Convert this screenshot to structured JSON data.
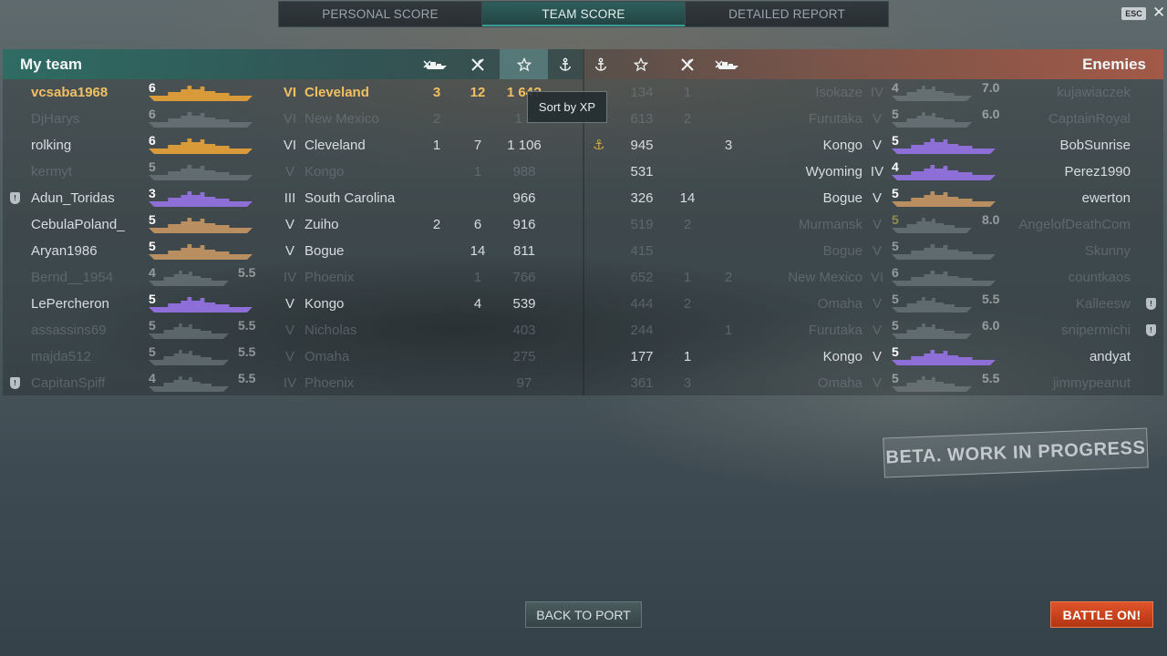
{
  "tabs": [
    {
      "label": "PERSONAL SCORE",
      "active": false
    },
    {
      "label": "TEAM SCORE",
      "active": true
    },
    {
      "label": "DETAILED REPORT",
      "active": false
    }
  ],
  "esc_label": "ESC",
  "close_glyph": "✕",
  "my_team": {
    "title": "My team",
    "columns": [
      "ships-destroyed-icon",
      "planes-destroyed-icon",
      "xp-star-icon",
      "base-capture-anchor-icon"
    ],
    "sorted_by": "xp",
    "rows": [
      {
        "name": "vcsaba1968",
        "lvl": "6",
        "tier": "VI",
        "ship": "Cleveland",
        "color": "#d99b3a",
        "kills": "3",
        "planes": "12",
        "xp": "1 64?",
        "cap": "",
        "player": true,
        "dim": false,
        "clan": false,
        "rating": ""
      },
      {
        "name": "DjHarys",
        "lvl": "6",
        "tier": "VI",
        "ship": "New Mexico",
        "color": "#8a969a",
        "kills": "2",
        "planes": "",
        "xp": "1 4",
        "cap": "",
        "player": false,
        "dim": true,
        "clan": false,
        "rating": ""
      },
      {
        "name": "rolking",
        "lvl": "6",
        "tier": "VI",
        "ship": "Cleveland",
        "color": "#d99b3a",
        "kills": "1",
        "planes": "7",
        "xp": "1 106",
        "cap": "",
        "player": false,
        "dim": false,
        "clan": false,
        "rating": ""
      },
      {
        "name": "kermyt",
        "lvl": "5",
        "tier": "V",
        "ship": "Kongo",
        "color": "#8a969a",
        "kills": "",
        "planes": "1",
        "xp": "988",
        "cap": "",
        "player": false,
        "dim": true,
        "clan": false,
        "rating": ""
      },
      {
        "name": "Adun_Toridas",
        "lvl": "3",
        "tier": "III",
        "ship": "South Carolina",
        "color": "#8e6fd8",
        "kills": "",
        "planes": "",
        "xp": "966",
        "cap": "",
        "player": false,
        "dim": false,
        "clan": true,
        "rating": ""
      },
      {
        "name": "CebulaPoland_",
        "lvl": "5",
        "tier": "V",
        "ship": "Zuiho",
        "color": "#b98f62",
        "kills": "2",
        "planes": "6",
        "xp": "916",
        "cap": "",
        "player": false,
        "dim": false,
        "clan": false,
        "rating": ""
      },
      {
        "name": "Aryan1986",
        "lvl": "5",
        "tier": "V",
        "ship": "Bogue",
        "color": "#b98f62",
        "kills": "",
        "planes": "14",
        "xp": "811",
        "cap": "",
        "player": false,
        "dim": false,
        "clan": false,
        "rating": ""
      },
      {
        "name": "Bernd__1954",
        "lvl": "4",
        "tier": "IV",
        "ship": "Phoenix",
        "color": "#8a969a",
        "kills": "",
        "planes": "1",
        "xp": "766",
        "cap": "",
        "player": false,
        "dim": true,
        "clan": false,
        "rating": "5.5"
      },
      {
        "name": "LePercheron",
        "lvl": "5",
        "tier": "V",
        "ship": "Kongo",
        "color": "#8e6fd8",
        "kills": "",
        "planes": "4",
        "xp": "539",
        "cap": "",
        "player": false,
        "dim": false,
        "clan": false,
        "rating": ""
      },
      {
        "name": "assassins69",
        "lvl": "5",
        "tier": "V",
        "ship": "Nicholas",
        "color": "#8a969a",
        "kills": "",
        "planes": "",
        "xp": "403",
        "cap": "",
        "player": false,
        "dim": true,
        "clan": false,
        "rating": "5.5"
      },
      {
        "name": "majda512",
        "lvl": "5",
        "tier": "V",
        "ship": "Omaha",
        "color": "#8a969a",
        "kills": "",
        "planes": "",
        "xp": "275",
        "cap": "",
        "player": false,
        "dim": true,
        "clan": false,
        "rating": "5.5"
      },
      {
        "name": "CapitanSpiff",
        "lvl": "4",
        "tier": "IV",
        "ship": "Phoenix",
        "color": "#8a969a",
        "kills": "",
        "planes": "",
        "xp": "97",
        "cap": "",
        "player": false,
        "dim": true,
        "clan": true,
        "rating": "5.5"
      }
    ]
  },
  "enemies": {
    "title": "Enemies",
    "columns": [
      "base-capture-anchor-icon",
      "xp-star-icon",
      "planes-destroyed-icon",
      "ships-destroyed-icon"
    ],
    "rows": [
      {
        "name": "kujawiaczek",
        "lvl": "4",
        "tier": "IV",
        "ship": "Isokaze",
        "color": "#8a969a",
        "cap": "",
        "xp": "134",
        "planes": "1",
        "kills": "",
        "dim": true,
        "clan": false,
        "rating": "7.0",
        "anchor": false,
        "yellow": false
      },
      {
        "name": "CaptainRoyal",
        "lvl": "5",
        "tier": "V",
        "ship": "Furutaka",
        "color": "#8a969a",
        "cap": "",
        "xp": "613",
        "planes": "2",
        "kills": "",
        "dim": true,
        "clan": false,
        "rating": "6.0",
        "anchor": false,
        "yellow": false
      },
      {
        "name": "BobSunrise",
        "lvl": "5",
        "tier": "V",
        "ship": "Kongo",
        "color": "#8e6fd8",
        "cap": "",
        "xp": "945",
        "planes": "",
        "kills": "3",
        "dim": false,
        "clan": false,
        "rating": "",
        "anchor": true,
        "yellow": false
      },
      {
        "name": "Perez1990",
        "lvl": "4",
        "tier": "IV",
        "ship": "Wyoming",
        "color": "#8e6fd8",
        "cap": "",
        "xp": "531",
        "planes": "",
        "kills": "",
        "dim": false,
        "clan": false,
        "rating": "",
        "anchor": false,
        "yellow": false
      },
      {
        "name": "ewerton",
        "lvl": "5",
        "tier": "V",
        "ship": "Bogue",
        "color": "#b98f62",
        "cap": "",
        "xp": "326",
        "planes": "14",
        "kills": "",
        "dim": false,
        "clan": false,
        "rating": "",
        "anchor": false,
        "yellow": false
      },
      {
        "name": "AngelofDeathCom",
        "lvl": "5",
        "tier": "V",
        "ship": "Murmansk",
        "color": "#8a969a",
        "cap": "",
        "xp": "519",
        "planes": "2",
        "kills": "",
        "dim": true,
        "clan": false,
        "rating": "8.0",
        "anchor": false,
        "yellow": true
      },
      {
        "name": "Skunny",
        "lvl": "5",
        "tier": "V",
        "ship": "Bogue",
        "color": "#8a969a",
        "cap": "",
        "xp": "415",
        "planes": "",
        "kills": "",
        "dim": true,
        "clan": false,
        "rating": "",
        "anchor": false,
        "yellow": false
      },
      {
        "name": "countkaos",
        "lvl": "6",
        "tier": "VI",
        "ship": "New Mexico",
        "color": "#8a969a",
        "cap": "",
        "xp": "652",
        "planes": "1",
        "kills": "2",
        "dim": true,
        "clan": false,
        "rating": "",
        "anchor": false,
        "yellow": false
      },
      {
        "name": "Kalleesw",
        "lvl": "5",
        "tier": "V",
        "ship": "Omaha",
        "color": "#8a969a",
        "cap": "",
        "xp": "444",
        "planes": "2",
        "kills": "",
        "dim": true,
        "clan": true,
        "rating": "5.5",
        "anchor": false,
        "yellow": false
      },
      {
        "name": "snipermichi",
        "lvl": "5",
        "tier": "V",
        "ship": "Furutaka",
        "color": "#8a969a",
        "cap": "",
        "xp": "244",
        "planes": "",
        "kills": "1",
        "dim": true,
        "clan": true,
        "rating": "6.0",
        "anchor": false,
        "yellow": false
      },
      {
        "name": "andyat",
        "lvl": "5",
        "tier": "V",
        "ship": "Kongo",
        "color": "#8e6fd8",
        "cap": "",
        "xp": "177",
        "planes": "1",
        "kills": "",
        "dim": false,
        "clan": false,
        "rating": "",
        "anchor": false,
        "yellow": false
      },
      {
        "name": "jimmypeanut",
        "lvl": "5",
        "tier": "V",
        "ship": "Omaha",
        "color": "#8a969a",
        "cap": "",
        "xp": "361",
        "planes": "3",
        "kills": "",
        "dim": true,
        "clan": false,
        "rating": "5.5",
        "anchor": false,
        "yellow": false
      }
    ]
  },
  "tooltip": "Sort by XP",
  "watermark": "BETA. WORK IN PROGRESS",
  "buttons": {
    "back": "BACK TO PORT",
    "battle": "BATTLE ON!"
  }
}
